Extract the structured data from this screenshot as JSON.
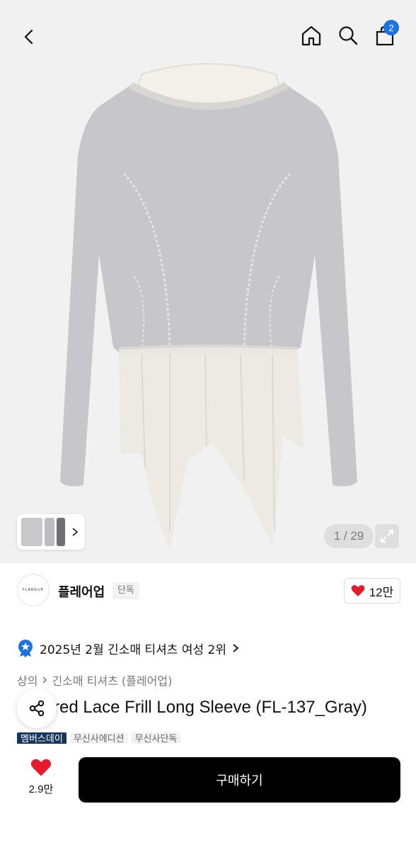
{
  "header": {
    "back_icon": "chevron-left-icon",
    "home_icon": "home-icon",
    "search_icon": "search-icon",
    "cart_icon": "shopping-bag-icon",
    "cart_count": "2"
  },
  "gallery": {
    "counter": "1 / 29",
    "expand_icon": "expand-icon",
    "thumbnails_chevron_icon": "chevron-right-icon"
  },
  "brand": {
    "logo_text": "FLAREUP",
    "name": "플레어업",
    "tag": "단독",
    "like_count": "12만"
  },
  "ranking": {
    "text": "2025년 2월 긴소매 티셔츠 여성 2위"
  },
  "breadcrumb": {
    "level1": "상의",
    "level2": "긴소매 티셔츠 (플레어업)"
  },
  "product": {
    "title": "Layered Lace Frill Long Sleeve (FL-137_Gray)",
    "badges": [
      "멤버스데이",
      "무신사에디션",
      "무신사단독"
    ]
  },
  "bottom_bar": {
    "wish_count": "2.9만",
    "buy_label": "구매하기"
  },
  "colors": {
    "accent_blue": "#1a73e8",
    "heart_red": "#e8192c",
    "badge_navy": "#14365f",
    "buy_button": "#000000"
  }
}
